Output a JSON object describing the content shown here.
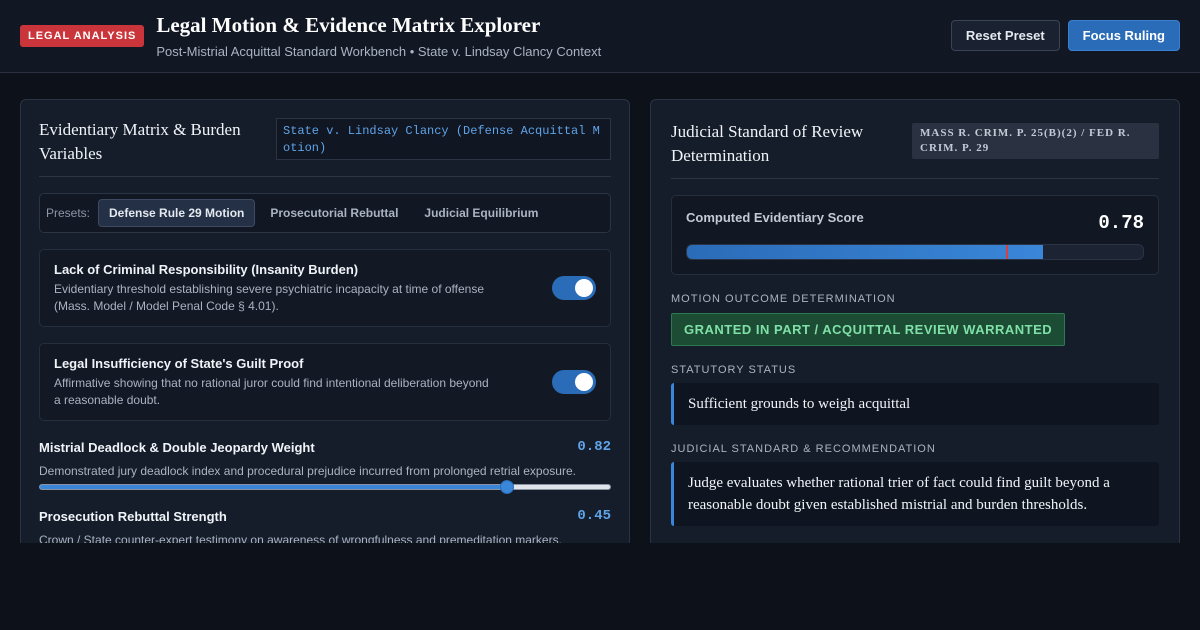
{
  "header": {
    "badge": "LEGAL ANALYSIS",
    "title": "Legal Motion & Evidence Matrix Explorer",
    "subtitle": "Post-Mistrial Acquittal Standard Workbench • State v. Lindsay Clancy Context",
    "reset_label": "Reset Preset",
    "focus_label": "Focus Ruling"
  },
  "left_panel": {
    "title": "Evidentiary Matrix & Burden Variables",
    "case_tag": "State v. Lindsay Clancy (Defense Acquittal Motion)",
    "presets_label": "Presets:",
    "presets": [
      {
        "label": "Defense Rule 29 Motion",
        "active": true
      },
      {
        "label": "Prosecutorial Rebuttal",
        "active": false
      },
      {
        "label": "Judicial Equilibrium",
        "active": false
      }
    ],
    "toggles": [
      {
        "title": "Lack of Criminal Responsibility (Insanity Burden)",
        "description": "Evidentiary threshold establishing severe psychiatric incapacity at time of offense (Mass. Model / Model Penal Code § 4.01).",
        "enabled": true
      },
      {
        "title": "Legal Insufficiency of State's Guilt Proof",
        "description": "Affirmative showing that no rational juror could find intentional deliberation beyond a reasonable doubt.",
        "enabled": true
      }
    ],
    "sliders": [
      {
        "title": "Mistrial Deadlock & Double Jeopardy Weight",
        "value": "0.82",
        "level": 0.82,
        "description": "Demonstrated jury deadlock index and procedural prejudice incurred from prolonged retrial exposure."
      },
      {
        "title": "Prosecution Rebuttal Strength",
        "value": "0.45",
        "level": 0.45,
        "description": "Crown / State counter-expert testimony on awareness of wrongfulness and premeditation markers."
      }
    ]
  },
  "right_panel": {
    "title": "Judicial Standard of Review Determination",
    "rule_tag": "MASS R. CRIM. P. 25(B)(2) / FED R. CRIM. P. 29",
    "score": {
      "label": "Computed Evidentiary Score",
      "value": "0.78",
      "level": 0.78,
      "threshold": 0.7
    },
    "outcome_label": "MOTION OUTCOME DETERMINATION",
    "outcome_value": "GRANTED IN PART / ACQUITTAL REVIEW WARRANTED",
    "statutory_label": "STATUTORY STATUS",
    "statutory_value": "Sufficient grounds to weigh acquittal",
    "standard_label": "JUDICIAL STANDARD & RECOMMENDATION",
    "standard_value": "Judge evaluates whether rational trier of fact could find guilt beyond a reasonable doubt given established mistrial and burden thresholds."
  },
  "colors": {
    "accent": "#2b6cb8",
    "danger_badge": "#c9353a",
    "success_text": "#7fe0a8",
    "background": "#0d1119"
  }
}
